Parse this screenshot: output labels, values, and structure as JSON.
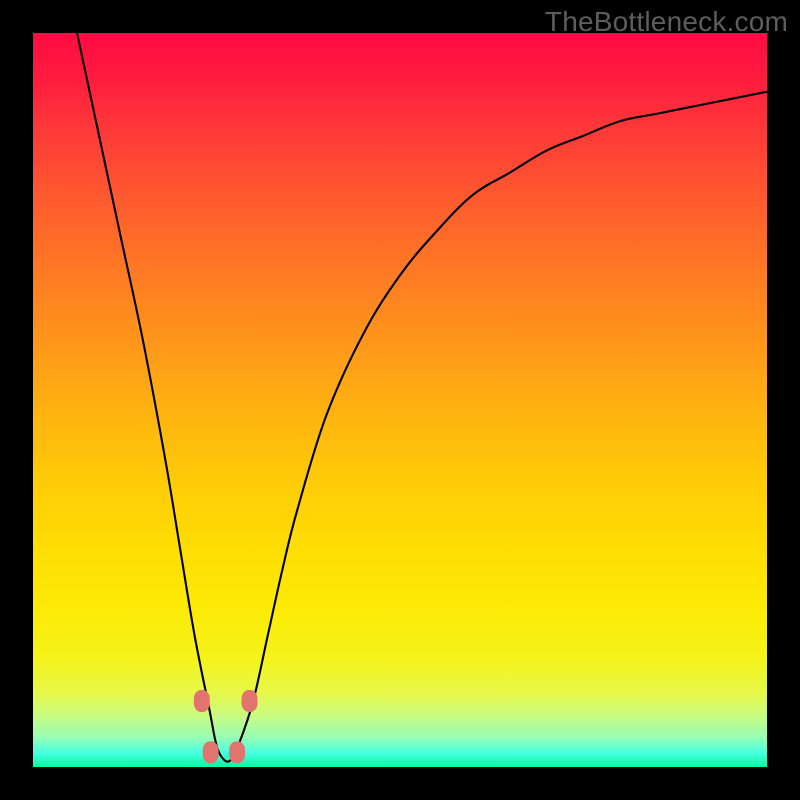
{
  "watermark": "TheBottleneck.com",
  "chart_data": {
    "type": "line",
    "title": "",
    "xlabel": "",
    "ylabel": "",
    "xlim": [
      0,
      100
    ],
    "ylim": [
      0,
      100
    ],
    "grid": false,
    "legend": false,
    "series": [
      {
        "name": "bottleneck-curve",
        "x": [
          6,
          9,
          12,
          15,
          18,
          20,
          22,
          24,
          25,
          26,
          27,
          28,
          30,
          32,
          34,
          36,
          40,
          45,
          50,
          55,
          60,
          65,
          70,
          75,
          80,
          85,
          90,
          95,
          100
        ],
        "values": [
          100,
          86,
          72,
          58,
          42,
          30,
          18,
          8,
          3,
          1,
          1,
          3,
          9,
          18,
          27,
          35,
          48,
          59,
          67,
          73,
          78,
          81,
          84,
          86,
          88,
          89,
          90,
          91,
          92
        ]
      }
    ],
    "markers": [
      {
        "x": 23.0,
        "y": 9.0
      },
      {
        "x": 24.2,
        "y": 2.0
      },
      {
        "x": 27.8,
        "y": 2.0
      },
      {
        "x": 29.5,
        "y": 9.0
      }
    ],
    "gradient_stops": [
      {
        "position": 0,
        "color": "#ff0b42"
      },
      {
        "position": 50,
        "color": "#ffae12"
      },
      {
        "position": 85,
        "color": "#f5f319"
      },
      {
        "position": 100,
        "color": "#00ffa5"
      }
    ]
  }
}
